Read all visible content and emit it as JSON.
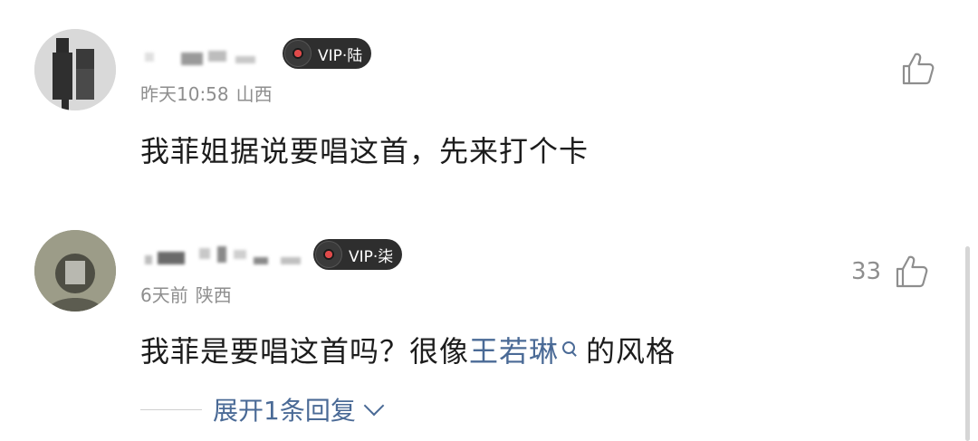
{
  "comments": [
    {
      "vip_label": "VIP·陆",
      "time": "昨天10:58",
      "location": "山西",
      "text": "我菲姐据说要唱这首，先来打个卡",
      "likes": ""
    },
    {
      "vip_label": "VIP·柒",
      "time": "6天前",
      "location": "陕西",
      "text_before": "我菲是要唱这首吗？很像",
      "text_link": "王若琳",
      "text_after": "的风格",
      "likes": "33"
    }
  ],
  "expand_replies_label": "展开1条回复",
  "colors": {
    "link": "#4a6a96",
    "meta": "#8e8e8e",
    "text": "#1c1c1c",
    "vip_badge_bg": "#2e2e2e"
  },
  "icons": [
    "vinyl-record-icon",
    "thumbs-up-icon",
    "search-icon",
    "chevron-down-icon"
  ]
}
